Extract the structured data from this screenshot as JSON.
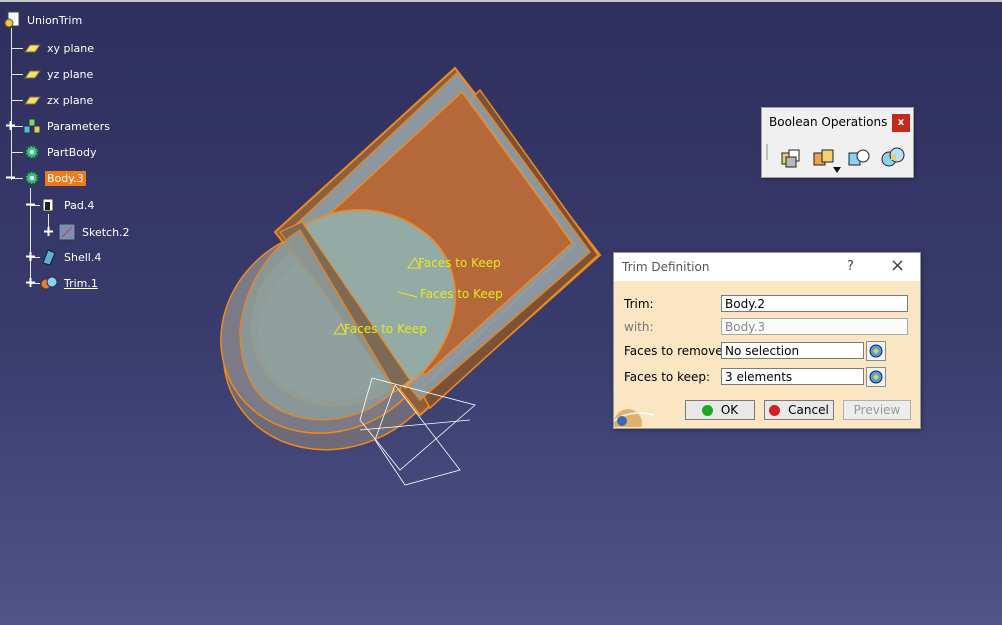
{
  "tree": {
    "root": {
      "label": "UnionTrim",
      "icon": "part-document-icon"
    },
    "items": [
      {
        "label": "xy plane",
        "icon": "plane-icon"
      },
      {
        "label": "yz plane",
        "icon": "plane-icon"
      },
      {
        "label": "zx plane",
        "icon": "plane-icon"
      },
      {
        "label": "Parameters",
        "icon": "parameters-icon"
      },
      {
        "label": "PartBody",
        "icon": "body-gear-icon"
      },
      {
        "label": "Body.3",
        "icon": "body-gear-icon",
        "selected": true
      }
    ],
    "children": [
      {
        "label": "Pad.4",
        "icon": "pad-icon"
      },
      {
        "label": "Sketch.2",
        "icon": "sketch-icon"
      },
      {
        "label": "Shell.4",
        "icon": "shell-icon"
      },
      {
        "label": "Trim.1",
        "icon": "trim-icon",
        "underlined": true
      }
    ]
  },
  "viewport": {
    "annotations": [
      "Faces to Keep",
      "Faces to Keep",
      "Faces to Keep"
    ],
    "highlight_color": "#f08a1e",
    "annotation_color": "#e8e820"
  },
  "bool_toolbar": {
    "title": "Boolean Operations",
    "close_label": "x",
    "buttons": [
      "assemble-icon",
      "add-icon",
      "remove-icon",
      "intersect-icon"
    ]
  },
  "trim_dialog": {
    "title": "Trim Definition",
    "help_label": "?",
    "close_label": "×",
    "fields": {
      "trim": {
        "label": "Trim:",
        "value": "Body.2"
      },
      "with": {
        "label": "with:",
        "value": "Body.3"
      },
      "faces_remove": {
        "label": "Faces to remove:",
        "value": "No selection"
      },
      "faces_keep": {
        "label": "Faces to keep:",
        "value": "3 elements"
      }
    },
    "buttons": {
      "ok": "OK",
      "cancel": "Cancel",
      "preview": "Preview"
    },
    "colors": {
      "background": "#fbe6c4",
      "ok_led": "#1fa81f",
      "cancel_led": "#d61f1f"
    }
  }
}
